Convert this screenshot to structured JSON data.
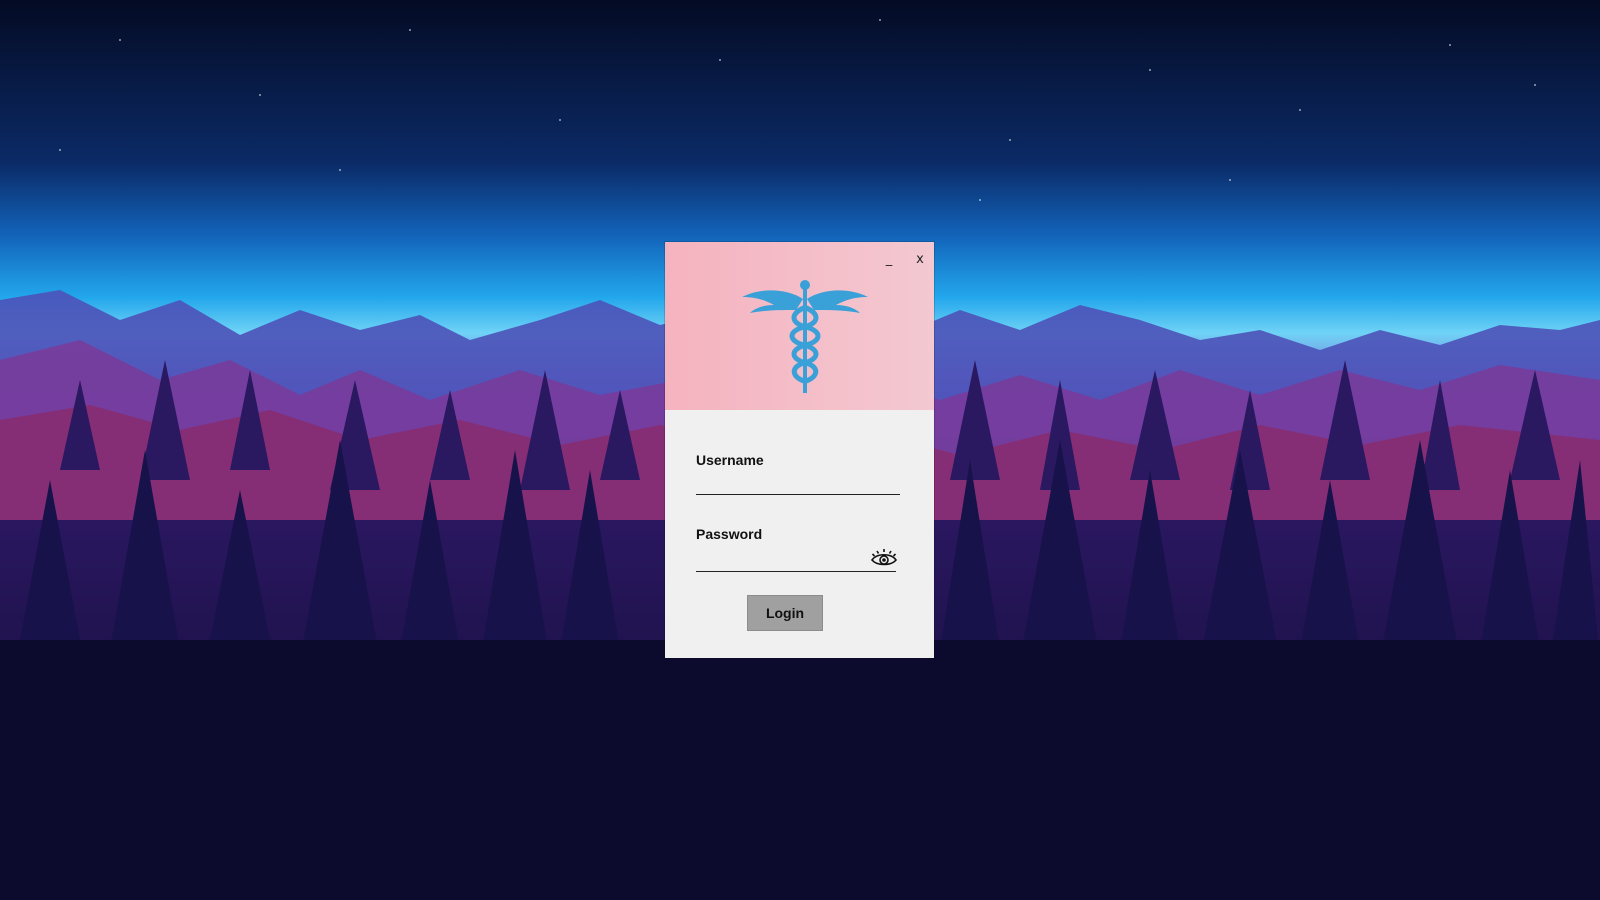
{
  "window": {
    "minimize_label": "_",
    "close_label": "x",
    "logo_icon": "caduceus-icon",
    "logo_color": "#3aa0d8",
    "header_color": "#f5b8c4"
  },
  "form": {
    "username_label": "Username",
    "username_value": "",
    "password_label": "Password",
    "password_value": "",
    "show_password_icon": "eye-icon",
    "login_label": "Login"
  },
  "background": {
    "description_icon": "mountain-forest-wallpaper"
  }
}
